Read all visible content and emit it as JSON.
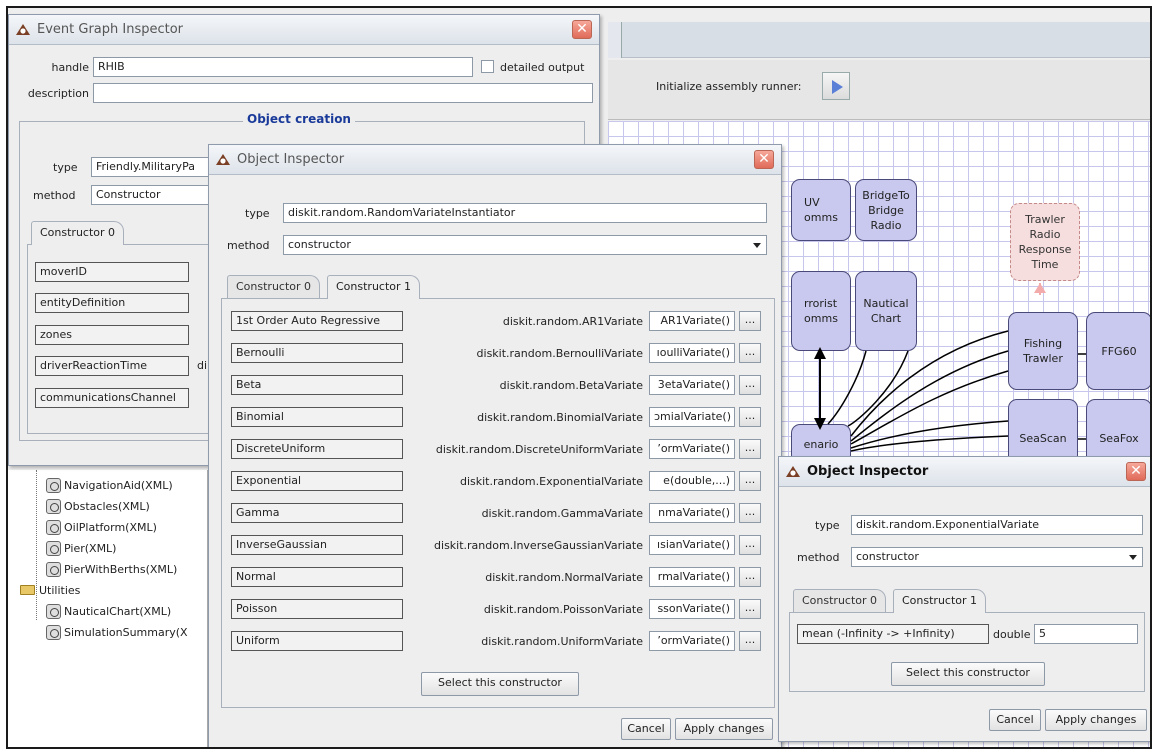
{
  "background": {
    "toolbar": {
      "init_label": "Initialize assembly runner:"
    },
    "nodes": [
      {
        "name": "node-uv-comms",
        "label": "UV\nomms"
      },
      {
        "name": "node-bridge-to-bridge",
        "label": "BridgeTo\nBridge\nRadio"
      },
      {
        "name": "node-trawler-radio",
        "label": "Trawler\nRadio\nResponse\nTime"
      },
      {
        "name": "node-terrorist-comms",
        "label": "rrorist\nomms"
      },
      {
        "name": "node-nautical-chart",
        "label": "Nautical\nChart"
      },
      {
        "name": "node-fishing-trawler",
        "label": "Fishing\nTrawler"
      },
      {
        "name": "node-ffg60",
        "label": "FFG60"
      },
      {
        "name": "node-seascan",
        "label": "SeaScan"
      },
      {
        "name": "node-seafox",
        "label": "SeaFox"
      },
      {
        "name": "node-scenario",
        "label": "enario"
      }
    ],
    "tree": {
      "items": [
        "NavigationAid(XML)",
        "Obstacles(XML)",
        "OilPlatform(XML)",
        "Pier(XML)",
        "PierWithBerths(XML)"
      ],
      "folder": "Utilities",
      "utilities": [
        "NauticalChart(XML)",
        "SimulationSummary(X"
      ]
    }
  },
  "event_graph_inspector": {
    "title": "Event Graph Inspector",
    "handle_label": "handle",
    "handle_value": "RHIB",
    "detailed_output": "detailed output",
    "description_label": "description",
    "description_value": "",
    "section_title": "Object creation",
    "type_label": "type",
    "type_value": "Friendly.MilitaryPa",
    "method_label": "method",
    "method_value": "Constructor",
    "tab": "Constructor 0",
    "params": [
      "moverID",
      "entityDefinition",
      "zones",
      "driverReactionTime",
      "communicationsChannel"
    ],
    "param_suffix": "di"
  },
  "object_inspector_main": {
    "title": "Object Inspector",
    "type_label": "type",
    "type_value": "diskit.random.RandomVariateInstantiator",
    "method_label": "method",
    "method_value": "constructor",
    "tabs": [
      "Constructor 0",
      "Constructor 1"
    ],
    "rows": [
      {
        "name": "1st Order Auto Regressive",
        "cls": "diskit.random.AR1Variate",
        "value": "AR1Variate()"
      },
      {
        "name": "Bernoulli",
        "cls": "diskit.random.BernoulliVariate",
        "value": "ıoulliVariate()"
      },
      {
        "name": "Beta",
        "cls": "diskit.random.BetaVariate",
        "value": "3etaVariate()"
      },
      {
        "name": "Binomial",
        "cls": "diskit.random.BinomialVariate",
        "value": "ɔmialVariate()"
      },
      {
        "name": "DiscreteUniform",
        "cls": "diskit.random.DiscreteUniformVariate",
        "value": "ʼormVariate()"
      },
      {
        "name": "Exponential",
        "cls": "diskit.random.ExponentialVariate",
        "value": "e(double,...)"
      },
      {
        "name": "Gamma",
        "cls": "diskit.random.GammaVariate",
        "value": "nmaVariate()"
      },
      {
        "name": "InverseGaussian",
        "cls": "diskit.random.InverseGaussianVariate",
        "value": "ısianVariate()"
      },
      {
        "name": "Normal",
        "cls": "diskit.random.NormalVariate",
        "value": "rmalVariate()"
      },
      {
        "name": "Poisson",
        "cls": "diskit.random.PoissonVariate",
        "value": "ssonVariate()"
      },
      {
        "name": "Uniform",
        "cls": "diskit.random.UniformVariate",
        "value": "ʼormVariate()"
      }
    ],
    "dots": "...",
    "select_button": "Select this constructor",
    "cancel": "Cancel",
    "apply": "Apply changes"
  },
  "object_inspector_small": {
    "title": "Object Inspector",
    "type_label": "type",
    "type_value": "diskit.random.ExponentialVariate",
    "method_label": "method",
    "method_value": "constructor",
    "tabs": [
      "Constructor 0",
      "Constructor 1"
    ],
    "param_name": "mean (-Infinity -> +Infinity)",
    "param_type": "double",
    "param_value": "5",
    "select_button": "Select this constructor",
    "cancel": "Cancel",
    "apply": "Apply changes"
  }
}
